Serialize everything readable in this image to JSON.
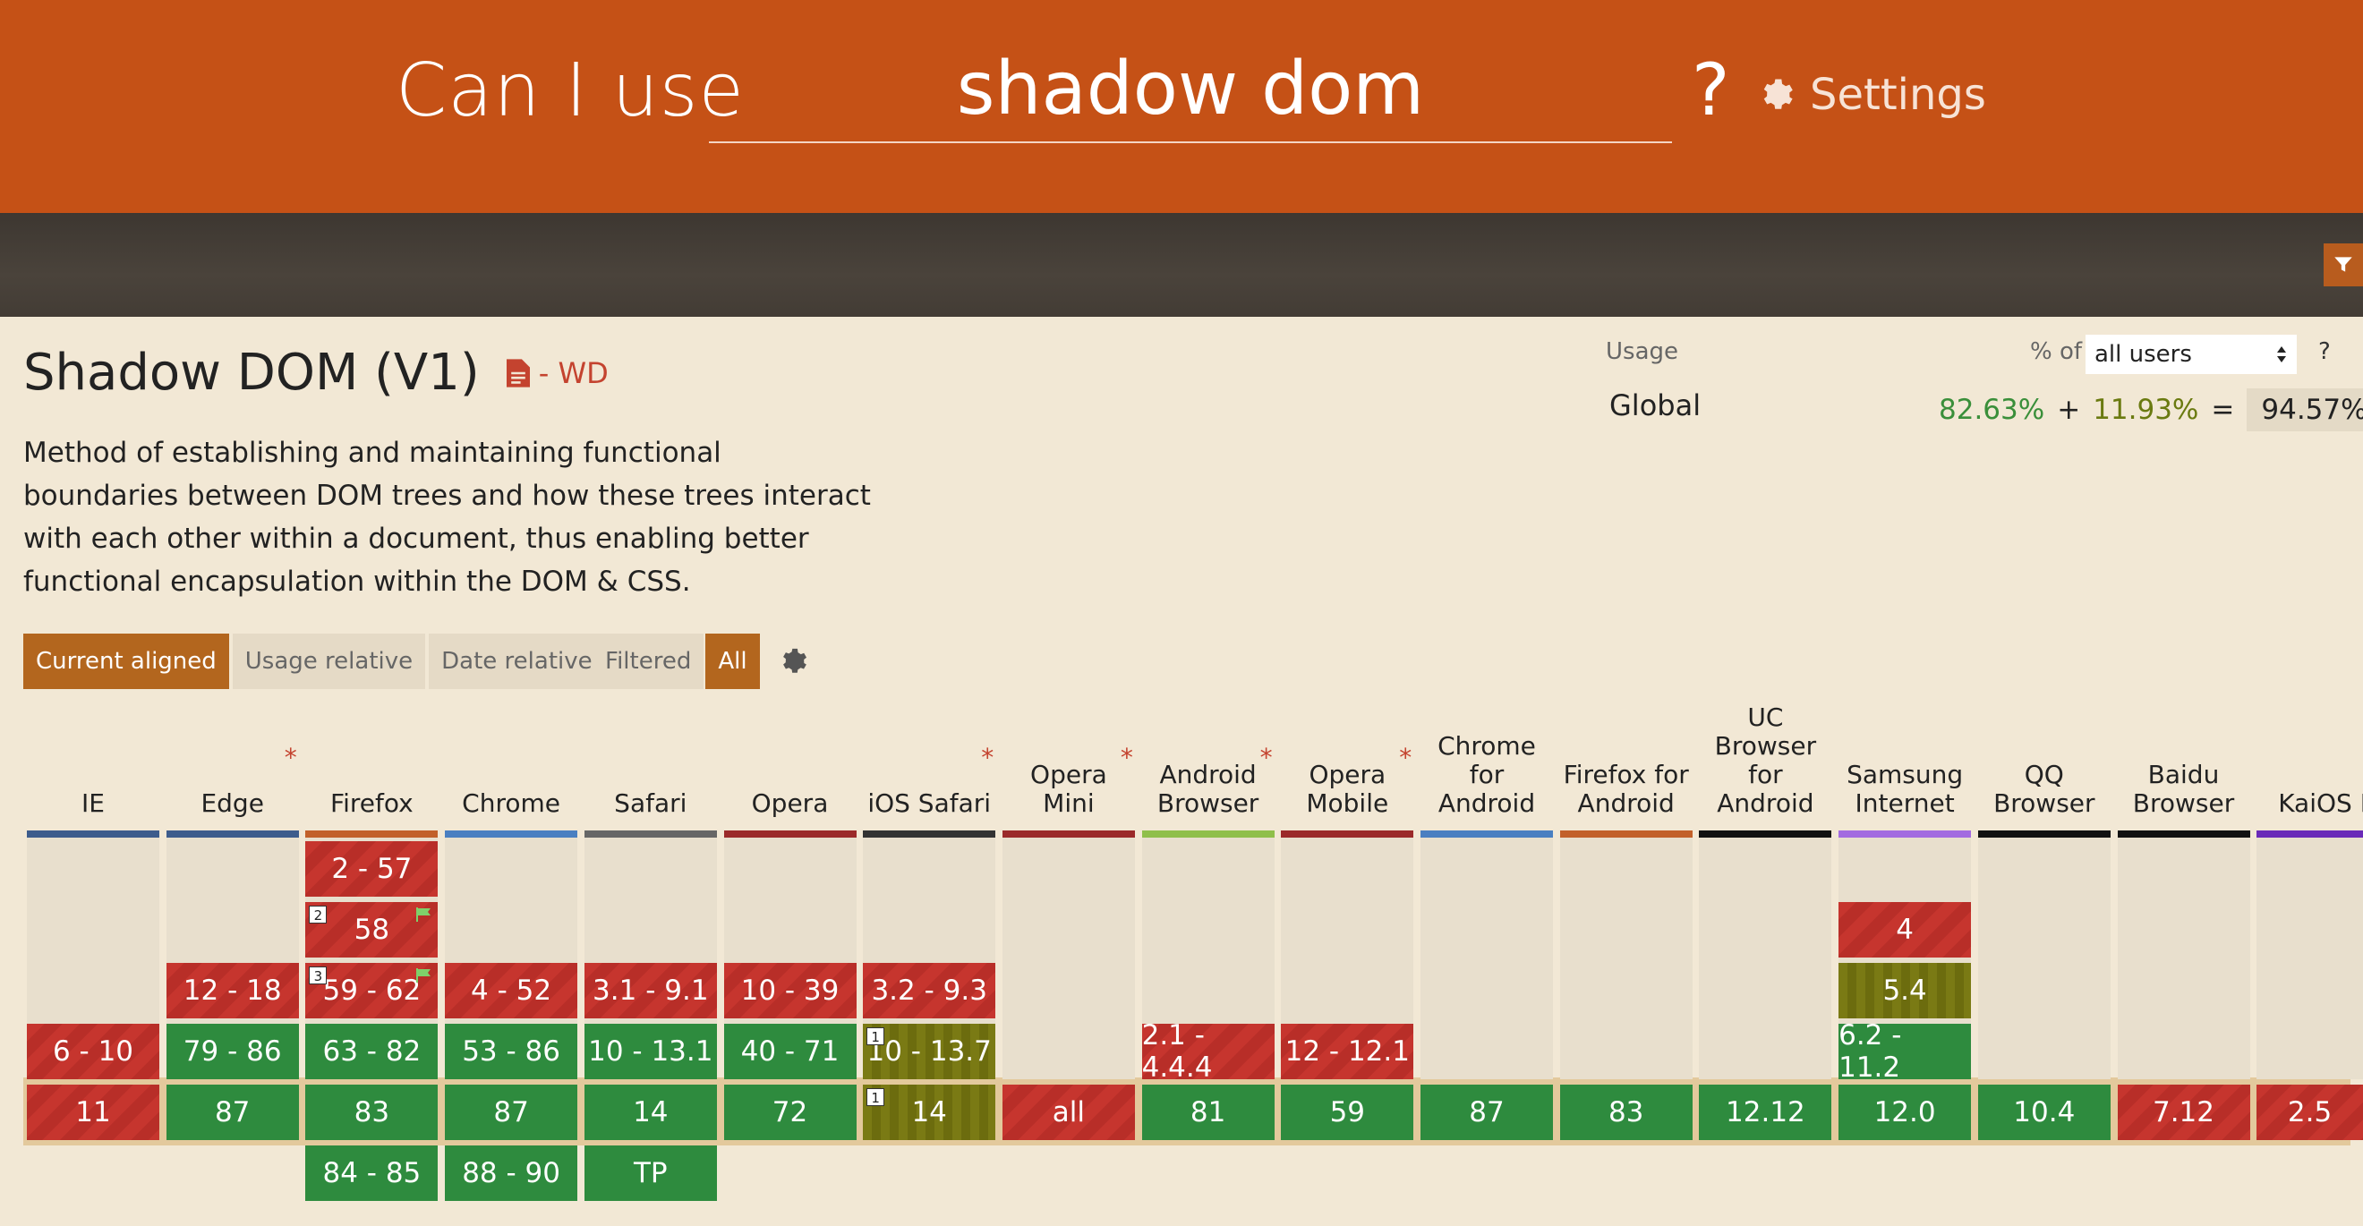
{
  "header": {
    "brand": "Can I use",
    "search_value": "shadow dom",
    "help": "?",
    "settings_label": "Settings"
  },
  "feature": {
    "title": "Shadow DOM (V1)",
    "status": "- WD",
    "description": "Method of establishing and maintaining functional boundaries between DOM trees and how these trees interact with each other within a document, thus enabling better functional encapsulation within the DOM & CSS."
  },
  "usage": {
    "label": "Usage",
    "pct_of": "% of",
    "select_value": "all users",
    "help": "?",
    "region": "Global",
    "supported": "82.63%",
    "plus": "+",
    "partial": "11.93%",
    "equals": "=",
    "total": "94.57%"
  },
  "tabs": {
    "current_aligned": "Current aligned",
    "usage_relative": "Usage relative",
    "date_relative": "Date relative",
    "filtered": "Filtered",
    "all": "All"
  },
  "colors": {
    "header": "#c55116",
    "supported": "#2e8b3e",
    "unsupported": "#c6352e",
    "partial": "#7a7a14",
    "background": "#f2e8d5"
  },
  "browsers": [
    {
      "name": "IE",
      "asterisk": false,
      "bar": "#3d5c8c",
      "cells": [
        {
          "row": 3,
          "text": "6 - 10",
          "s": "n"
        },
        {
          "row": 4,
          "text": "11",
          "s": "n"
        }
      ]
    },
    {
      "name": "Edge",
      "asterisk": true,
      "bar": "#3d5c8c",
      "cells": [
        {
          "row": 2,
          "text": "12 - 18",
          "s": "n"
        },
        {
          "row": 3,
          "text": "79 - 86",
          "s": "y"
        },
        {
          "row": 4,
          "text": "87",
          "s": "y"
        }
      ]
    },
    {
      "name": "Firefox",
      "asterisk": false,
      "bar": "#c2602a",
      "cells": [
        {
          "row": 0,
          "text": "2 - 57",
          "s": "n"
        },
        {
          "row": 1,
          "text": "58",
          "s": "n",
          "note": "2",
          "flag": true
        },
        {
          "row": 2,
          "text": "59 - 62",
          "s": "n",
          "note": "3",
          "flag": true
        },
        {
          "row": 3,
          "text": "63 - 82",
          "s": "y"
        },
        {
          "row": 4,
          "text": "83",
          "s": "y"
        },
        {
          "row": 5,
          "text": "84 - 85",
          "s": "y"
        }
      ]
    },
    {
      "name": "Chrome",
      "asterisk": false,
      "bar": "#4a7fc1",
      "cells": [
        {
          "row": 2,
          "text": "4 - 52",
          "s": "n"
        },
        {
          "row": 3,
          "text": "53 - 86",
          "s": "y"
        },
        {
          "row": 4,
          "text": "87",
          "s": "y"
        },
        {
          "row": 5,
          "text": "88 - 90",
          "s": "y"
        }
      ]
    },
    {
      "name": "Safari",
      "asterisk": false,
      "bar": "#666666",
      "cells": [
        {
          "row": 2,
          "text": "3.1 - 9.1",
          "s": "n"
        },
        {
          "row": 3,
          "text": "10 - 13.1",
          "s": "y"
        },
        {
          "row": 4,
          "text": "14",
          "s": "y"
        },
        {
          "row": 5,
          "text": "TP",
          "s": "y"
        }
      ]
    },
    {
      "name": "Opera",
      "asterisk": false,
      "bar": "#9b2a2a",
      "cells": [
        {
          "row": 2,
          "text": "10 - 39",
          "s": "n"
        },
        {
          "row": 3,
          "text": "40 - 71",
          "s": "y"
        },
        {
          "row": 4,
          "text": "72",
          "s": "y"
        }
      ]
    },
    {
      "name": "iOS Safari",
      "asterisk": true,
      "bar": "#333333",
      "cells": [
        {
          "row": 2,
          "text": "3.2 - 9.3",
          "s": "n"
        },
        {
          "row": 3,
          "text": "10 - 13.7",
          "s": "p",
          "note": "1"
        },
        {
          "row": 4,
          "text": "14",
          "s": "p",
          "note": "1"
        }
      ]
    },
    {
      "name": "Opera Mini",
      "asterisk": true,
      "bar": "#9b2a2a",
      "cells": [
        {
          "row": 4,
          "text": "all",
          "s": "n"
        }
      ]
    },
    {
      "name": "Android Browser",
      "asterisk": true,
      "bar": "#8fbf4a",
      "cells": [
        {
          "row": 3,
          "text": "2.1 - 4.4.4",
          "s": "n"
        },
        {
          "row": 4,
          "text": "81",
          "s": "y"
        }
      ]
    },
    {
      "name": "Opera Mobile",
      "asterisk": true,
      "bar": "#9b2a2a",
      "cells": [
        {
          "row": 3,
          "text": "12 - 12.1",
          "s": "n"
        },
        {
          "row": 4,
          "text": "59",
          "s": "y"
        }
      ]
    },
    {
      "name": "Chrome for Android",
      "asterisk": false,
      "bar": "#4a7fc1",
      "cells": [
        {
          "row": 4,
          "text": "87",
          "s": "y"
        }
      ]
    },
    {
      "name": "Firefox for Android",
      "asterisk": false,
      "bar": "#c2602a",
      "cells": [
        {
          "row": 4,
          "text": "83",
          "s": "y"
        }
      ]
    },
    {
      "name": "UC Browser for Android",
      "asterisk": false,
      "bar": "#111111",
      "cells": [
        {
          "row": 4,
          "text": "12.12",
          "s": "y"
        }
      ]
    },
    {
      "name": "Samsung Internet",
      "asterisk": false,
      "bar": "#a36be0",
      "cells": [
        {
          "row": 1,
          "text": "4",
          "s": "n"
        },
        {
          "row": 2,
          "text": "5.4",
          "s": "p"
        },
        {
          "row": 3,
          "text": "6.2 - 11.2",
          "s": "y"
        },
        {
          "row": 4,
          "text": "12.0",
          "s": "y"
        }
      ]
    },
    {
      "name": "QQ Browser",
      "asterisk": false,
      "bar": "#111111",
      "cells": [
        {
          "row": 4,
          "text": "10.4",
          "s": "y"
        }
      ]
    },
    {
      "name": "Baidu Browser",
      "asterisk": false,
      "bar": "#111111",
      "cells": [
        {
          "row": 4,
          "text": "7.12",
          "s": "n"
        }
      ]
    },
    {
      "name": "KaiOS Browser",
      "asterisk": false,
      "bar": "#6a2ab8",
      "cells": [
        {
          "row": 4,
          "text": "2.5",
          "s": "n"
        }
      ]
    }
  ]
}
